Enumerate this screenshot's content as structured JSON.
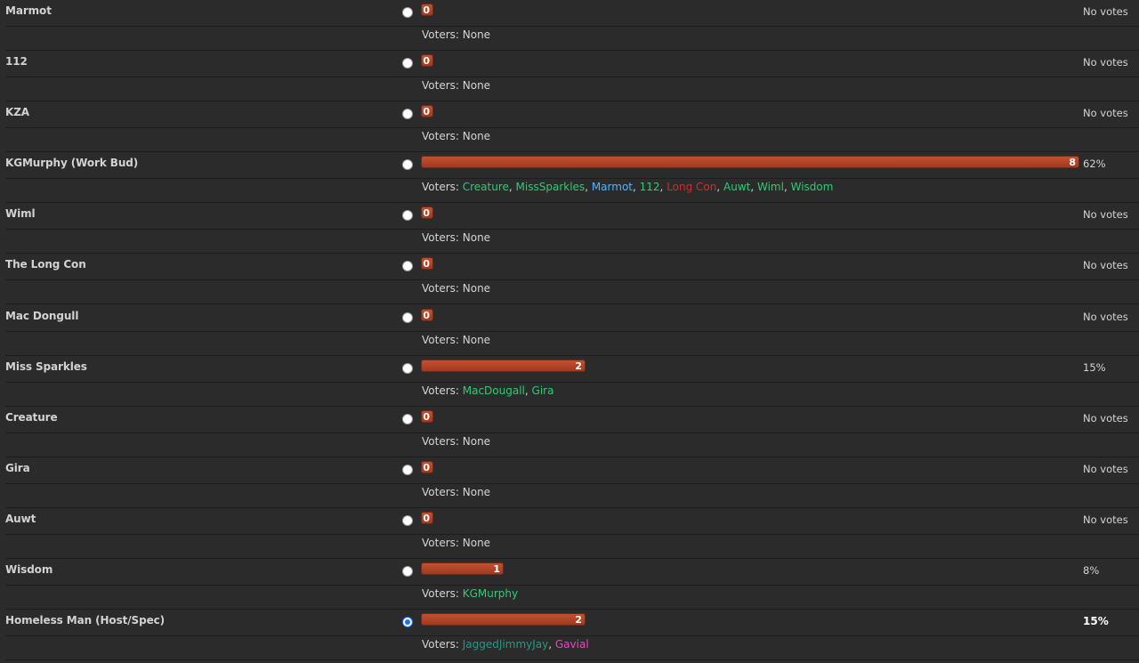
{
  "voters_label": "Voters:",
  "none_label": "None",
  "options": [
    {
      "name": "Marmot",
      "votes": 0,
      "percent_label": "No votes",
      "fraction": 0,
      "selected": false,
      "voters": []
    },
    {
      "name": "112",
      "votes": 0,
      "percent_label": "No votes",
      "fraction": 0,
      "selected": false,
      "voters": []
    },
    {
      "name": "KZA",
      "votes": 0,
      "percent_label": "No votes",
      "fraction": 0,
      "selected": false,
      "voters": []
    },
    {
      "name": "KGMurphy (Work Bud)",
      "votes": 8,
      "percent_label": "62%",
      "fraction": 1.0,
      "selected": false,
      "voters": [
        {
          "name": "Creature",
          "color": "#2ecc71"
        },
        {
          "name": "MissSparkles",
          "color": "#2ecc71"
        },
        {
          "name": "Marmot",
          "color": "#4fb6ff"
        },
        {
          "name": "112",
          "color": "#2ecc71"
        },
        {
          "name": "Long Con",
          "color": "#e0262b"
        },
        {
          "name": "Auwt",
          "color": "#2ecc71"
        },
        {
          "name": "Wiml",
          "color": "#2ecc71"
        },
        {
          "name": "Wisdom",
          "color": "#2ecc71"
        }
      ]
    },
    {
      "name": "Wiml",
      "votes": 0,
      "percent_label": "No votes",
      "fraction": 0,
      "selected": false,
      "voters": []
    },
    {
      "name": "The Long Con",
      "votes": 0,
      "percent_label": "No votes",
      "fraction": 0,
      "selected": false,
      "voters": []
    },
    {
      "name": "Mac Dongull",
      "votes": 0,
      "percent_label": "No votes",
      "fraction": 0,
      "selected": false,
      "voters": []
    },
    {
      "name": "Miss Sparkles",
      "votes": 2,
      "percent_label": "15%",
      "fraction": 0.25,
      "selected": false,
      "voters": [
        {
          "name": "MacDougall",
          "color": "#2ecc71"
        },
        {
          "name": "Gira",
          "color": "#2ecc71"
        }
      ]
    },
    {
      "name": "Creature",
      "votes": 0,
      "percent_label": "No votes",
      "fraction": 0,
      "selected": false,
      "voters": []
    },
    {
      "name": "Gira",
      "votes": 0,
      "percent_label": "No votes",
      "fraction": 0,
      "selected": false,
      "voters": []
    },
    {
      "name": "Auwt",
      "votes": 0,
      "percent_label": "No votes",
      "fraction": 0,
      "selected": false,
      "voters": []
    },
    {
      "name": "Wisdom",
      "votes": 1,
      "percent_label": "8%",
      "fraction": 0.125,
      "selected": false,
      "voters": [
        {
          "name": "KGMurphy",
          "color": "#2ecc71"
        }
      ]
    },
    {
      "name": "Homeless Man (Host/Spec)",
      "votes": 2,
      "percent_label": "15%",
      "fraction": 0.25,
      "selected": true,
      "voters": [
        {
          "name": "JaggedJimmyJay",
          "color": "#1a9e8a"
        },
        {
          "name": "Gavial",
          "color": "#ff3cc8"
        }
      ]
    }
  ]
}
